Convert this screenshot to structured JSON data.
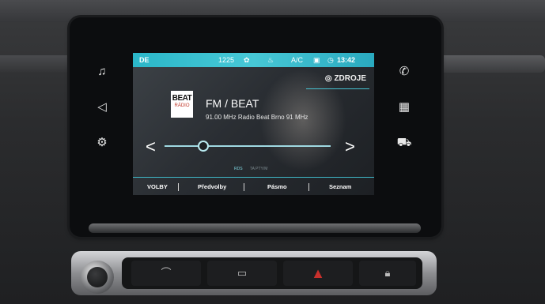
{
  "statusbar": {
    "left_icon": "DE",
    "temp": "1225",
    "ac": "A/C",
    "time": "13:42"
  },
  "sources": {
    "label": "ZDROJE"
  },
  "station": {
    "logo_top": "BEAT",
    "logo_bottom": "RÁDIO",
    "name": "FM / BEAT",
    "frequency_line": "91.00 MHz Radio Beat Brno 91 MHz"
  },
  "rds": {
    "label": "RDS",
    "dim_label": "TA PTY/M"
  },
  "menu": {
    "items": [
      {
        "label": "VOLBY"
      },
      {
        "label": "Předvolby"
      },
      {
        "label": "Pásmo"
      },
      {
        "label": "Seznam"
      }
    ]
  },
  "side_icons": {
    "left": [
      "music-note-icon",
      "navigation-icon",
      "apps-icon"
    ],
    "right": [
      "phone-icon",
      "grid-icon",
      "car-icon"
    ]
  },
  "colors": {
    "accent": "#2bb7c9",
    "hazard": "#c8302c"
  }
}
